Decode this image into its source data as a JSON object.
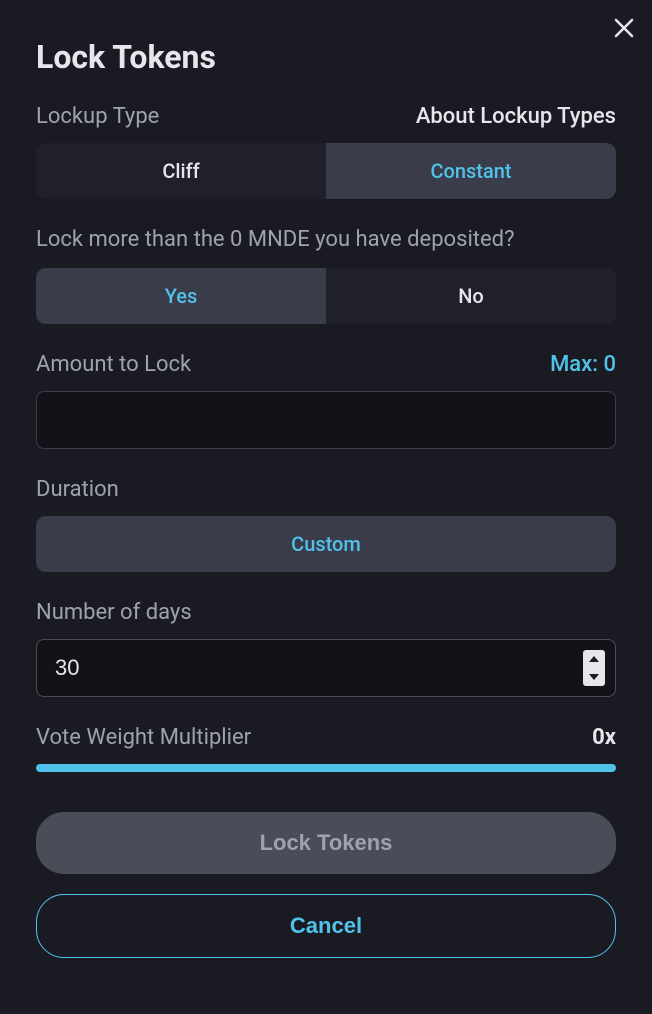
{
  "modal": {
    "title": "Lock Tokens",
    "lockup_type": {
      "label": "Lockup Type",
      "about": "About Lockup Types",
      "options": {
        "cliff": "Cliff",
        "constant": "Constant"
      }
    },
    "lock_more": {
      "question": "Lock more than the 0 MNDE you have deposited?",
      "options": {
        "yes": "Yes",
        "no": "No"
      }
    },
    "amount": {
      "label": "Amount to Lock",
      "max_label": "Max: 0",
      "value": ""
    },
    "duration": {
      "label": "Duration",
      "option": "Custom"
    },
    "days": {
      "label": "Number of days",
      "value": "30"
    },
    "multiplier": {
      "label": "Vote Weight Multiplier",
      "value": "0x"
    },
    "buttons": {
      "primary": "Lock Tokens",
      "secondary": "Cancel"
    }
  }
}
